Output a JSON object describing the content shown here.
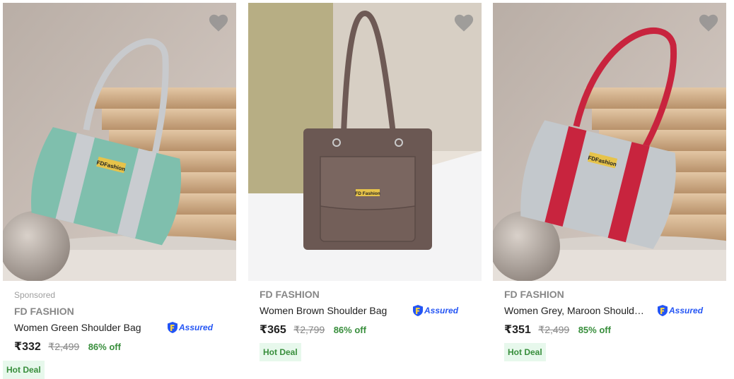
{
  "products": [
    {
      "sponsored": "Sponsored",
      "brand": "FD FASHION",
      "title": "Women Green Shoulder Bag",
      "assured": "Assured",
      "price": "₹332",
      "mrp": "₹2,499",
      "discount": "86% off",
      "tag": "Hot Deal",
      "logo_text": "FDFashion",
      "bag_color": "#7fbfad",
      "stripe_color": "#c9ccd0",
      "strap_color": "#c8cacd"
    },
    {
      "brand": "FD FASHION",
      "title": "Women Brown Shoulder Bag",
      "assured": "Assured",
      "price": "₹365",
      "mrp": "₹2,799",
      "discount": "86% off",
      "tag": "Hot Deal",
      "logo_text": "FD Fashion",
      "bag_color": "#6b5853",
      "strap_color": "#6e5a55"
    },
    {
      "brand": "FD FASHION",
      "title": "Women Grey, Maroon Shoulder ...",
      "assured": "Assured",
      "price": "₹351",
      "mrp": "₹2,499",
      "discount": "85% off",
      "tag": "Hot Deal",
      "logo_text": "FDFashion",
      "bag_color": "#c3c8cc",
      "stripe_color": "#c8243e",
      "strap_color": "#c8243e"
    }
  ],
  "icons": {
    "wishlist": "heart-icon",
    "assured": "assured-shield-icon"
  },
  "colors": {
    "discount_green": "#388e3c",
    "assured_blue": "#2455f4",
    "tag_bg": "#e7f8ec"
  }
}
